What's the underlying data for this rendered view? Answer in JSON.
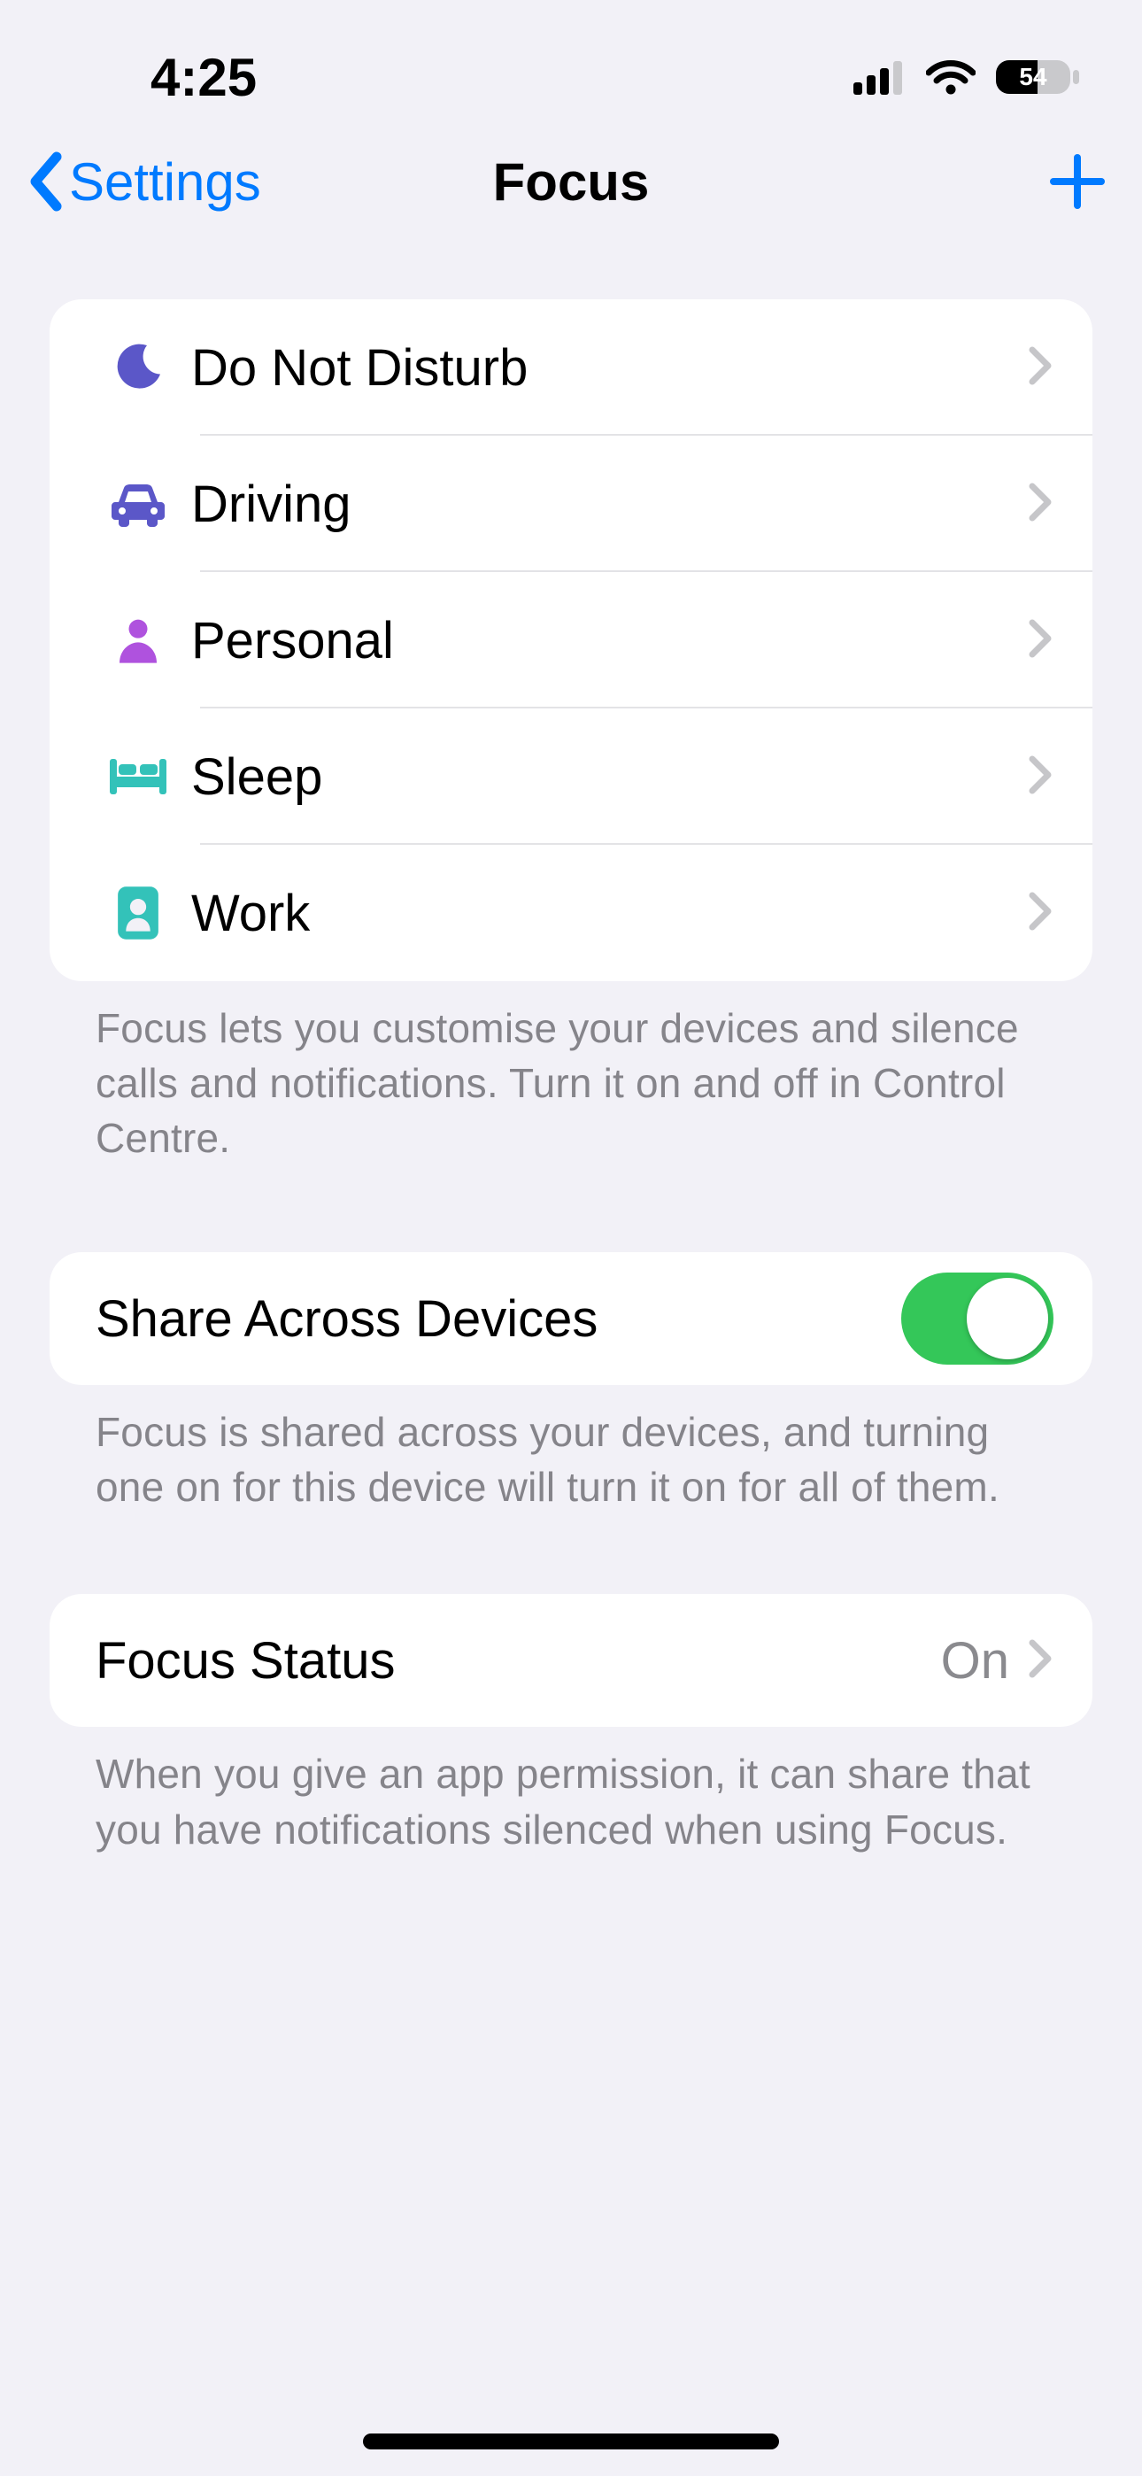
{
  "status": {
    "time": "4:25",
    "battery_pct": "54"
  },
  "nav": {
    "back_label": "Settings",
    "title": "Focus"
  },
  "focus_list": [
    {
      "label": "Do Not Disturb",
      "icon": "moon",
      "icon_name": "moon-icon",
      "color": "#5b57c8"
    },
    {
      "label": "Driving",
      "icon": "car",
      "icon_name": "car-icon",
      "color": "#5b57c8"
    },
    {
      "label": "Personal",
      "icon": "person",
      "icon_name": "person-icon",
      "color": "#af52de"
    },
    {
      "label": "Sleep",
      "icon": "bed",
      "icon_name": "bed-icon",
      "color": "#33c2b9"
    },
    {
      "label": "Work",
      "icon": "badge",
      "icon_name": "badge-icon",
      "color": "#33c2b9"
    }
  ],
  "focus_list_footer": "Focus lets you customise your devices and silence calls and notifications. Turn it on and off in Control Centre.",
  "share": {
    "label": "Share Across Devices",
    "enabled": true,
    "footer": "Focus is shared across your devices, and turning one on for this device will turn it on for all of them."
  },
  "status_option": {
    "label": "Focus Status",
    "value": "On",
    "footer": "When you give an app permission, it can share that you have notifications silenced when using Focus."
  }
}
